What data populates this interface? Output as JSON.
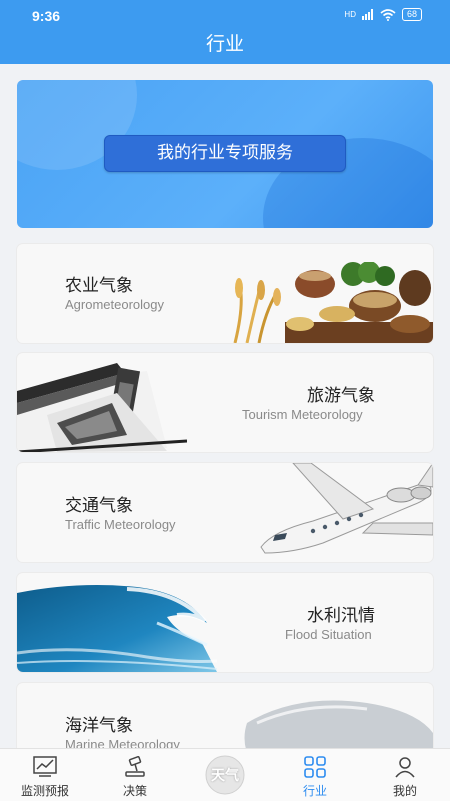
{
  "status": {
    "time": "9:36",
    "battery": "68",
    "network": "HD"
  },
  "header": {
    "title": "行业"
  },
  "banner": {
    "button_label": "我的行业专项服务"
  },
  "cards": [
    {
      "zh": "农业气象",
      "en": "Agrometeorology"
    },
    {
      "zh": "旅游气象",
      "en": "Tourism Meteorology"
    },
    {
      "zh": "交通气象",
      "en": "Traffic Meteorology"
    },
    {
      "zh": "水利汛情",
      "en": "Flood Situation"
    },
    {
      "zh": "海洋气象",
      "en": "Marine Meteorology"
    }
  ],
  "tabbar": {
    "items": [
      {
        "label": "监测预报",
        "icon": "chart-icon"
      },
      {
        "label": "决策",
        "icon": "gavel-icon"
      },
      {
        "label": "天气",
        "icon": "weather-logo"
      },
      {
        "label": "行业",
        "icon": "grid-icon"
      },
      {
        "label": "我的",
        "icon": "user-icon"
      }
    ],
    "active": "行业",
    "active_color": "#2d8cf0"
  },
  "colors": {
    "brand": "#3d9bf0",
    "banner_button": "#2f6fd8"
  }
}
